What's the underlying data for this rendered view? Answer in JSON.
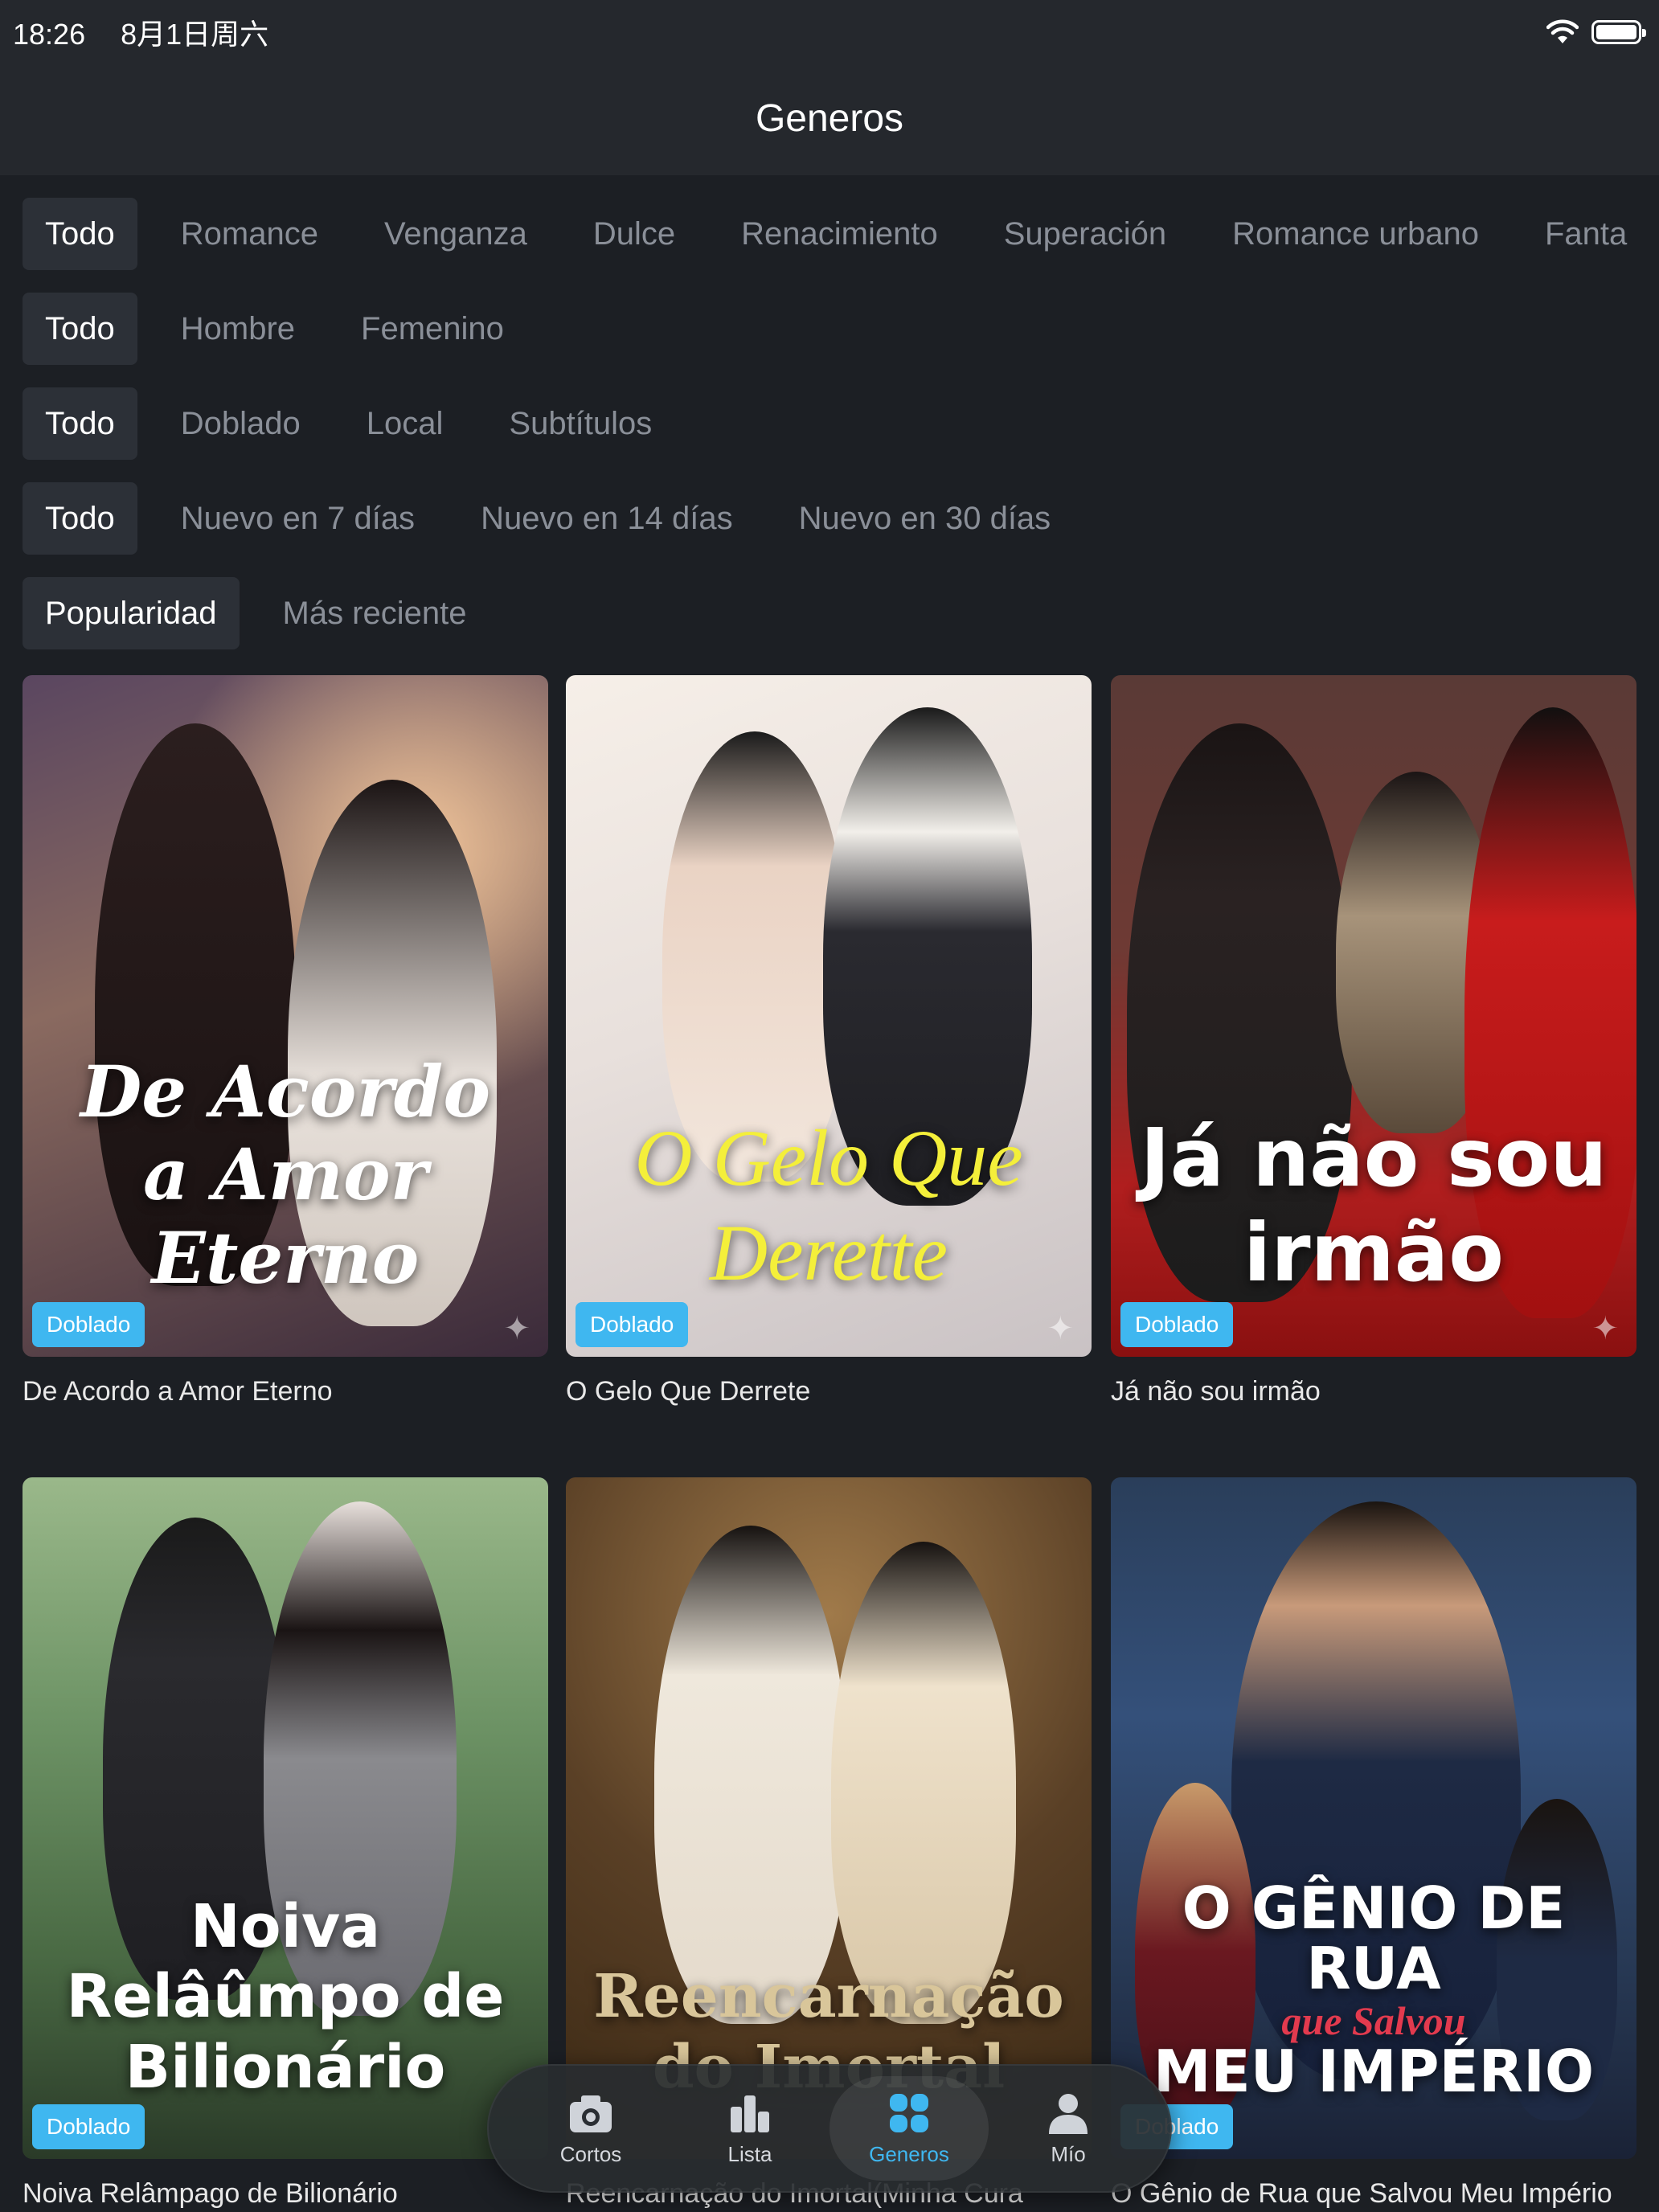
{
  "status": {
    "time": "18:26",
    "date": "8月1日周六"
  },
  "header": {
    "title": "Generos"
  },
  "filters": {
    "genre": [
      "Todo",
      "Romance",
      "Venganza",
      "Dulce",
      "Renacimiento",
      "Superación",
      "Romance urbano",
      "Fanta"
    ],
    "audience": [
      "Todo",
      "Hombre",
      "Femenino"
    ],
    "language": [
      "Todo",
      "Doblado",
      "Local",
      "Subtítulos"
    ],
    "recency": [
      "Todo",
      "Nuevo en 7 días",
      "Nuevo en 14 días",
      "Nuevo en 30 días"
    ],
    "sort": [
      "Popularidad",
      "Más reciente"
    ]
  },
  "cards": [
    {
      "poster_text": "De Acordo a Amor Eterno",
      "badge": "Doblado",
      "title": "De Acordo a Amor Eterno"
    },
    {
      "poster_text": "O Gelo Que Derette",
      "badge": "Doblado",
      "title": "O Gelo Que Derrete"
    },
    {
      "poster_text": "Já não sou irmão",
      "badge": "Doblado",
      "title": "Já não sou irmão"
    },
    {
      "poster_text": "Noiva Relâûmpo de Bilionário",
      "badge": "Doblado",
      "title": "Noiva Relâmpago de Bilionário"
    },
    {
      "poster_text": "Reencarnação do Imortal",
      "badge": "",
      "title": "Reencarnação do Imortal(Minha Cura"
    },
    {
      "poster_text_main": "O GÊNIO DE RUA",
      "poster_text_sub": "que Salvou",
      "poster_text_end": "MEU IMPÉRIO",
      "badge": "Doblado",
      "title": "O Gênio de Rua que Salvou Meu Império"
    }
  ],
  "tabbar": {
    "tabs": [
      {
        "label": "Cortos",
        "icon": "camera-icon"
      },
      {
        "label": "Lista",
        "icon": "list-icon"
      },
      {
        "label": "Generos",
        "icon": "grid-icon",
        "active": true
      },
      {
        "label": "Mío",
        "icon": "profile-icon"
      }
    ]
  },
  "colors": {
    "accent": "#3fb7f0",
    "background": "#1c1f24",
    "header": "#25282d"
  }
}
